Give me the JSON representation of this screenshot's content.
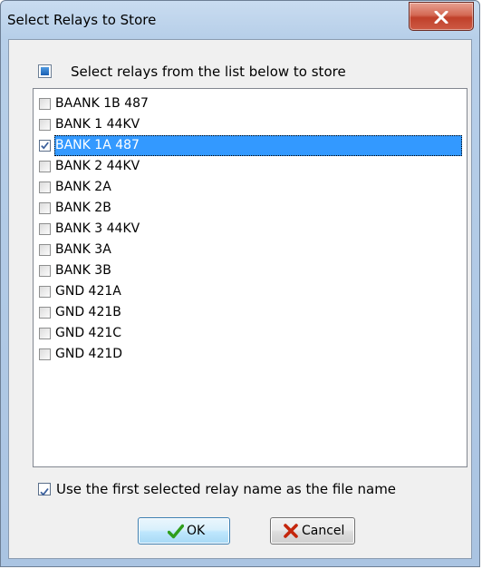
{
  "window": {
    "title": "Select Relays to Store",
    "close_icon": "close-icon"
  },
  "header": {
    "label": "Select relays from the list below to store",
    "state": "indeterminate"
  },
  "relays": [
    {
      "label": "BAANK 1B 487",
      "checked": false,
      "selected": false
    },
    {
      "label": "BANK 1 44KV",
      "checked": false,
      "selected": false
    },
    {
      "label": "BANK 1A 487",
      "checked": true,
      "selected": true
    },
    {
      "label": "BANK 2 44KV",
      "checked": false,
      "selected": false
    },
    {
      "label": "BANK 2A",
      "checked": false,
      "selected": false
    },
    {
      "label": "BANK 2B",
      "checked": false,
      "selected": false
    },
    {
      "label": "BANK 3 44KV",
      "checked": false,
      "selected": false
    },
    {
      "label": "BANK 3A",
      "checked": false,
      "selected": false
    },
    {
      "label": "BANK 3B",
      "checked": false,
      "selected": false
    },
    {
      "label": "GND 421A",
      "checked": false,
      "selected": false
    },
    {
      "label": "GND 421B",
      "checked": false,
      "selected": false
    },
    {
      "label": "GND 421C",
      "checked": false,
      "selected": false
    },
    {
      "label": "GND 421D",
      "checked": false,
      "selected": false
    }
  ],
  "options": {
    "use_first_name_label": "Use the first selected relay name as the file name",
    "use_first_name_checked": true
  },
  "buttons": {
    "ok_label": "OK",
    "ok_icon": "checkmark-icon",
    "cancel_label": "Cancel",
    "cancel_icon": "x-cross-icon"
  },
  "colors": {
    "selection": "#3399ff",
    "ok_check": "#2e9e1b",
    "cancel_x": "#c4260c",
    "close_button": "#c9503a"
  }
}
